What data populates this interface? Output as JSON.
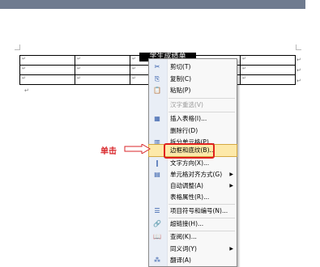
{
  "table": {
    "title": "学生成绩单",
    "marks": [
      "↵",
      "↵",
      "↵",
      "↵",
      "↵",
      "↵"
    ],
    "end_mark": "↵"
  },
  "callout": {
    "text": "单击"
  },
  "menu": {
    "items": [
      {
        "label": "剪切(T)",
        "icon": "✂",
        "icon_name": "scissors-icon",
        "disabled": false
      },
      {
        "label": "复制(C)",
        "icon": "⎘",
        "icon_name": "copy-icon",
        "disabled": false
      },
      {
        "label": "粘贴(P)",
        "icon": "📋",
        "icon_name": "paste-icon",
        "disabled": false
      },
      {
        "label": "汉字重选(V)",
        "icon": "",
        "icon_name": "",
        "disabled": true
      },
      {
        "label": "插入表格(I)...",
        "icon": "▦",
        "icon_name": "insert-table-icon",
        "disabled": false
      },
      {
        "label": "删除行(D)",
        "icon": "",
        "icon_name": "",
        "disabled": false
      },
      {
        "label": "拆分单元格(P)...",
        "icon": "▥",
        "icon_name": "split-cells-icon",
        "disabled": false
      },
      {
        "label": "边框和底纹(B)...",
        "icon": "",
        "icon_name": "",
        "disabled": false,
        "highlighted": true
      },
      {
        "label": "文字方向(X)...",
        "icon": "‖",
        "icon_name": "text-direction-icon",
        "disabled": false
      },
      {
        "label": "单元格对齐方式(G)",
        "icon": "▤",
        "icon_name": "cell-alignment-icon",
        "disabled": false,
        "submenu": true
      },
      {
        "label": "自动调整(A)",
        "icon": "",
        "icon_name": "",
        "disabled": false,
        "submenu": true
      },
      {
        "label": "表格属性(R)...",
        "icon": "",
        "icon_name": "",
        "disabled": false
      },
      {
        "label": "项目符号和编号(N)...",
        "icon": "☰",
        "icon_name": "bullets-numbering-icon",
        "disabled": false
      },
      {
        "label": "超链接(H)...",
        "icon": "🔗",
        "icon_name": "hyperlink-icon",
        "disabled": false
      },
      {
        "label": "查阅(K)...",
        "icon": "📖",
        "icon_name": "lookup-icon",
        "disabled": false
      },
      {
        "label": "同义词(Y)",
        "icon": "",
        "icon_name": "",
        "disabled": false,
        "submenu": true
      },
      {
        "label": "翻译(A)",
        "icon": "⁂",
        "icon_name": "translate-icon",
        "disabled": false
      }
    ],
    "submenu_arrow": "▶"
  }
}
